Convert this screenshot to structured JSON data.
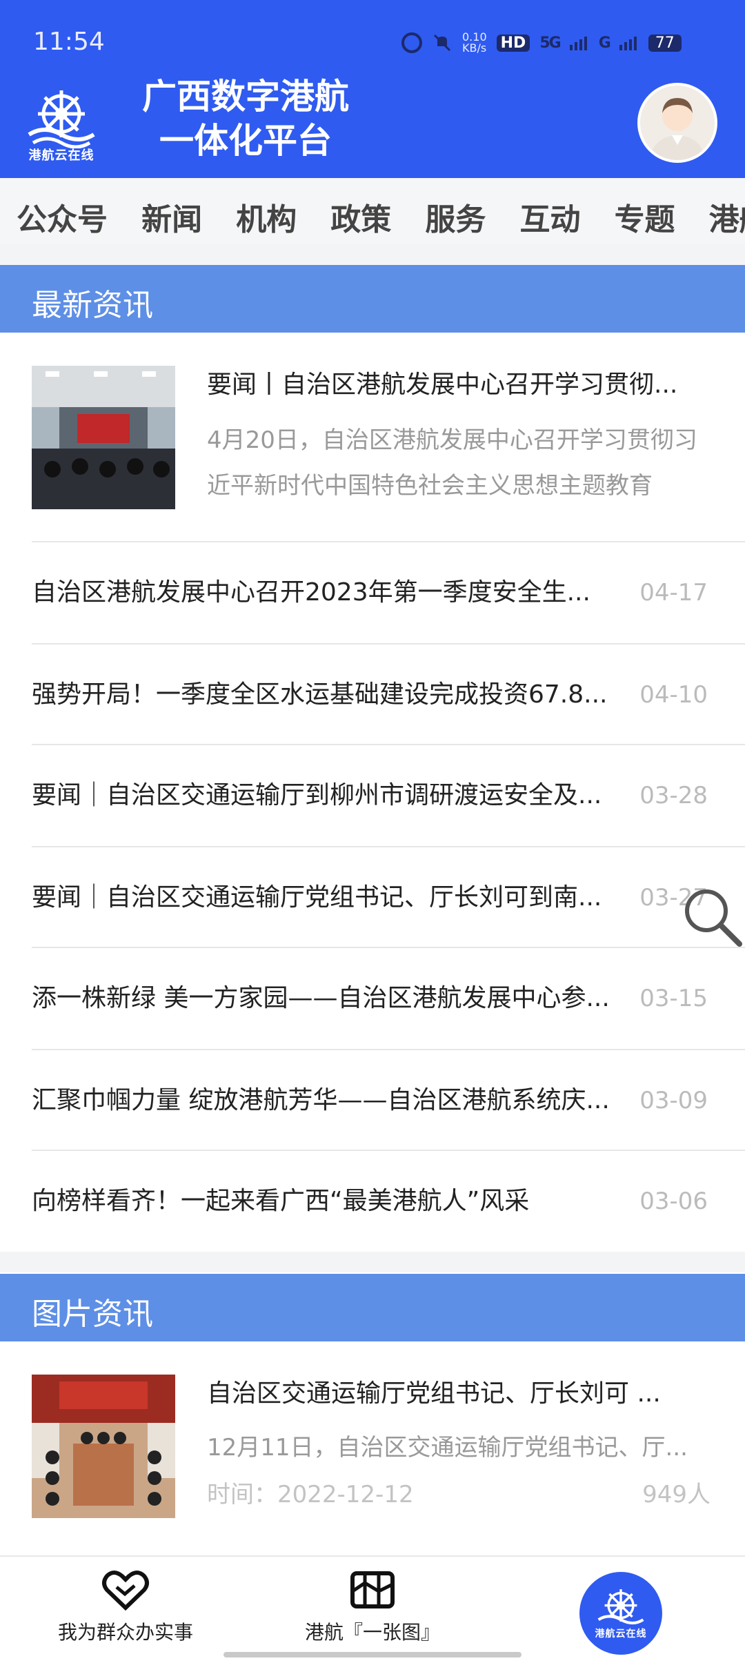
{
  "status_bar": {
    "time": "11:54",
    "speed_value": "0.10",
    "speed_unit": "KB/s",
    "hd": "HD",
    "signal_1": "5G",
    "signal_2": "G",
    "battery": "77"
  },
  "header": {
    "logo_text": "港航云在线",
    "title_line1": "广西数字港航",
    "title_line2": "一体化平台",
    "accent_color": "#2f5bf0"
  },
  "tabs": [
    "公众号",
    "新闻",
    "机构",
    "政策",
    "服务",
    "互动",
    "专题",
    "港航"
  ],
  "latest": {
    "section_title": "最新资讯",
    "featured": {
      "title": "要闻丨自治区港航发展中心召开学习贯彻...",
      "desc": "4月20日，自治区港航发展中心召开学习贯彻习近平新时代中国特色社会主义思想主题教育"
    },
    "items": [
      {
        "title": "自治区港航发展中心召开2023年第一季度安全生...",
        "date": "04-17"
      },
      {
        "title": "强势开局！一季度全区水运基础建设完成投资67.8...",
        "date": "04-10"
      },
      {
        "title": "要闻｜自治区交通运输厅到柳州市调研渡运安全及...",
        "date": "03-28"
      },
      {
        "title": "要闻｜自治区交通运输厅党组书记、厅长刘可到南...",
        "date": "03-27"
      },
      {
        "title": "添一株新绿 美一方家园——自治区港航发展中心参...",
        "date": "03-15"
      },
      {
        "title": "汇聚巾帼力量 绽放港航芳华——自治区港航系统庆...",
        "date": "03-09"
      },
      {
        "title": "向榜样看齐！一起来看广西“最美港航人”风采",
        "date": "03-06"
      }
    ]
  },
  "pictures": {
    "section_title": "图片资讯",
    "item": {
      "title": "自治区交通运输厅党组书记、厅长刘可 ...",
      "desc": "12月11日，自治区交通运输厅党组书记、厅...",
      "time": "时间：2022-12-12",
      "views": "949人"
    }
  },
  "bottom_nav": {
    "item1": "我为群众办实事",
    "item2": "港航『一张图』",
    "center_logo_text": "港航云在线"
  }
}
